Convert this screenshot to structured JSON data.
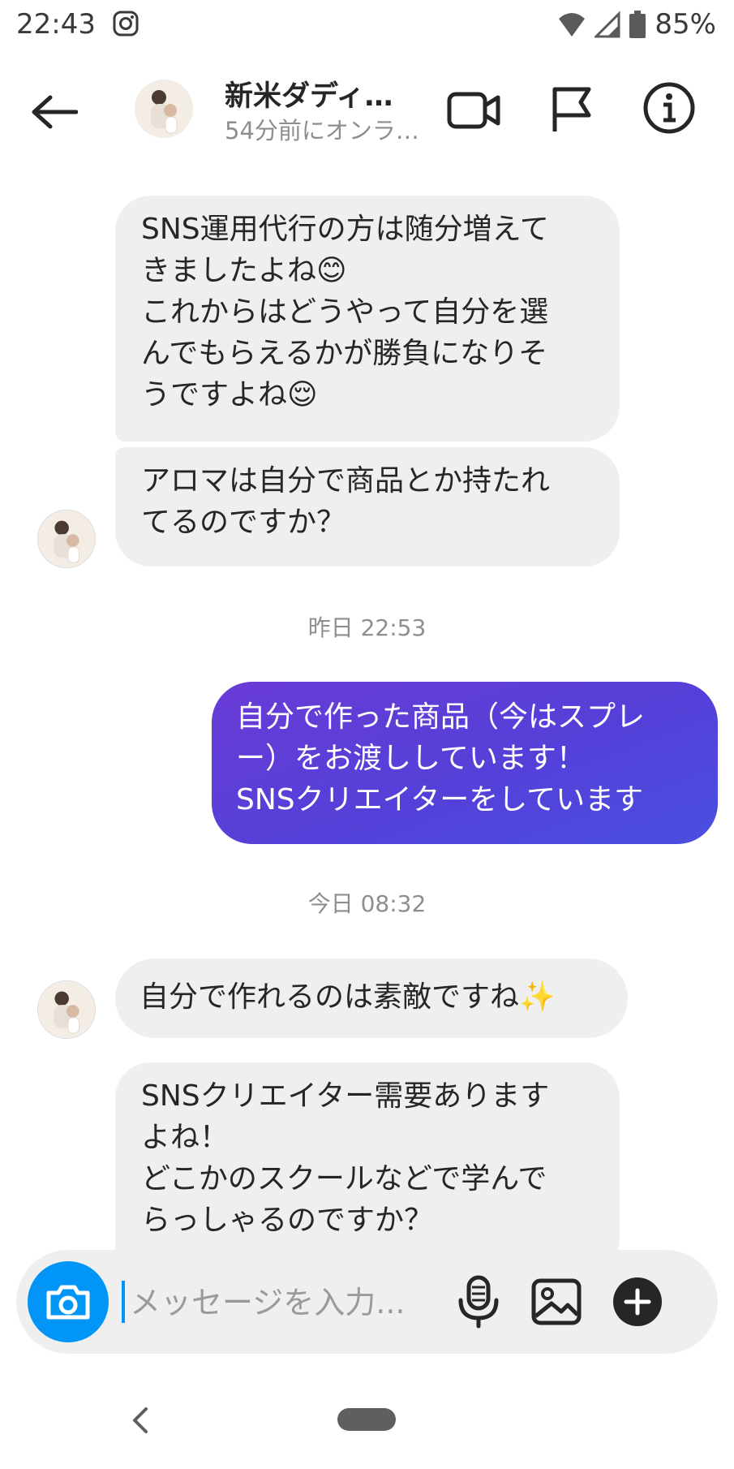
{
  "status_bar": {
    "time": "22:43",
    "battery": "85%"
  },
  "header": {
    "name": "新米ダディ…",
    "status": "54分前にオンラ…"
  },
  "messages": [
    {
      "text": "SNS運用代行の方は随分増えて\nきましたよね😊\nこれからはどうやって自分を選\nんでもらえるかが勝負になりそ\nうですよね😌"
    },
    {
      "text": "アロマは自分で商品とか持たれ\nてるのですか？"
    },
    {
      "text": "自分で作った商品（今はスプレ\nー）をお渡ししています！\nSNSクリエイターをしています"
    },
    {
      "text": "自分で作れるのは素敵ですね✨"
    },
    {
      "text": "SNSクリエイター需要あります\nよね！\nどこかのスクールなどで学んで\nらっしゃるのですか？"
    }
  ],
  "timestamps": [
    "昨日 22:53",
    "今日 08:32"
  ],
  "composer": {
    "placeholder": "メッセージを入力..."
  },
  "colors": {
    "sent_bubble": "#5440d8",
    "received_bubble": "#efefef",
    "accent": "#0095f6"
  }
}
